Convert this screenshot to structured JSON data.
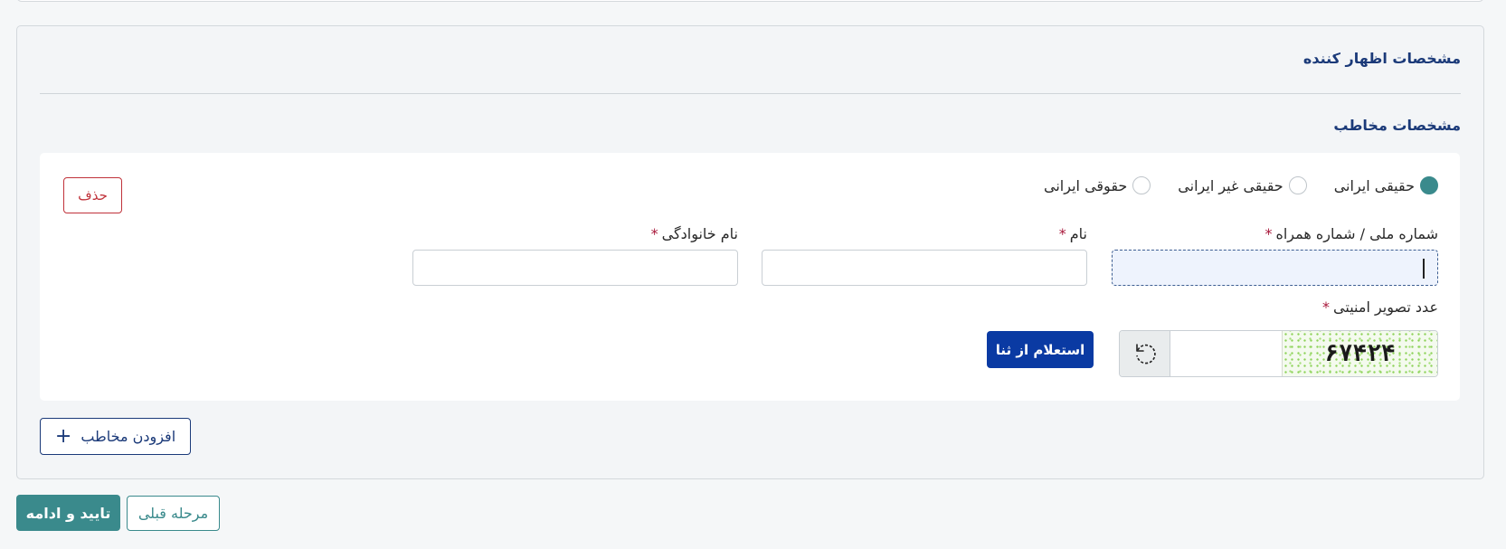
{
  "sections": {
    "declarant_title": "مشخصات اظهار کننده",
    "audience_title": "مشخصات مخاطب"
  },
  "person_types": [
    {
      "label": "حقیقی ایرانی",
      "selected": true
    },
    {
      "label": "حقیقی غیر ایرانی",
      "selected": false
    },
    {
      "label": "حقوقی ایرانی",
      "selected": false
    }
  ],
  "delete_label": "حذف",
  "fields": {
    "national_label": "شماره ملی / شماره همراه",
    "name_label": "نام",
    "family_label": "نام خانوادگی",
    "required_mark": "*",
    "national_value": "",
    "name_value": "",
    "family_value": ""
  },
  "captcha": {
    "label": "عدد تصویر امنیتی",
    "code": "۶۷۴۲۴",
    "value": ""
  },
  "inquire_label": "استعلام از ثنا",
  "add_audience_label": "افزودن مخاطب",
  "footer": {
    "confirm_label": "تایید و ادامه",
    "prev_label": "مرحله قبلی"
  },
  "colors": {
    "primary_navy": "#1b3a79",
    "teal": "#3a8a8c",
    "blue_button": "#0a3aa3",
    "danger": "#c0323a"
  }
}
